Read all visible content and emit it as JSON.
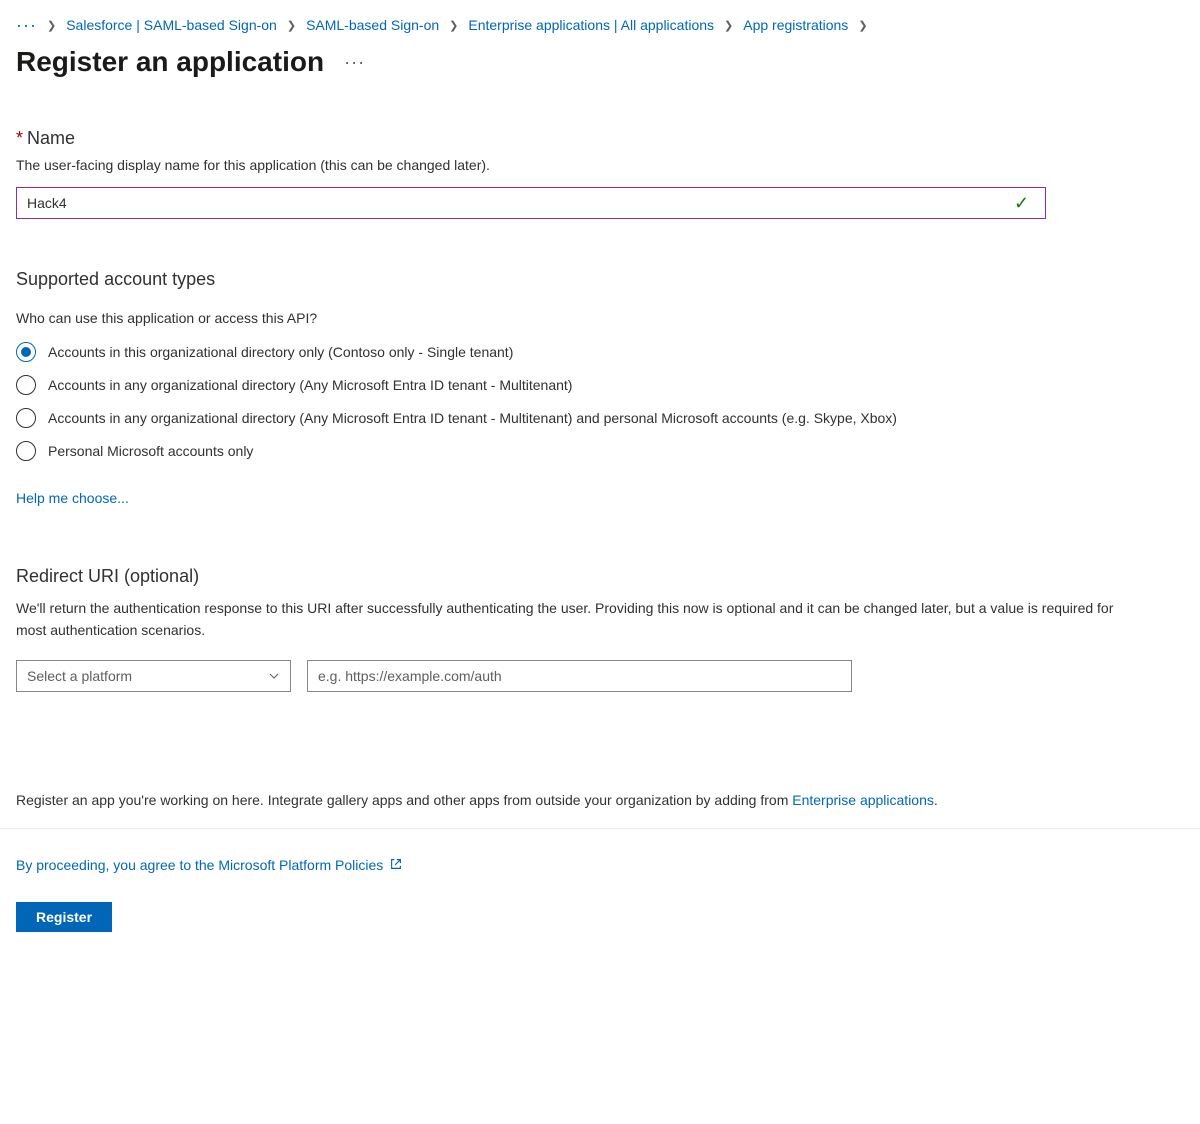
{
  "breadcrumb": {
    "items": [
      "Salesforce | SAML-based Sign-on",
      "SAML-based Sign-on",
      "Enterprise applications | All applications",
      "App registrations"
    ]
  },
  "page": {
    "title": "Register an application"
  },
  "name_section": {
    "label": "Name",
    "description": "The user-facing display name for this application (this can be changed later).",
    "value": "Hack4"
  },
  "account_section": {
    "heading": "Supported account types",
    "question": "Who can use this application or access this API?",
    "options": [
      "Accounts in this organizational directory only (Contoso only - Single tenant)",
      "Accounts in any organizational directory (Any Microsoft Entra ID tenant - Multitenant)",
      "Accounts in any organizational directory (Any Microsoft Entra ID tenant - Multitenant) and personal Microsoft accounts (e.g. Skype, Xbox)",
      "Personal Microsoft accounts only"
    ],
    "help_link": "Help me choose..."
  },
  "redirect_section": {
    "heading": "Redirect URI (optional)",
    "description": "We'll return the authentication response to this URI after successfully authenticating the user. Providing this now is optional and it can be changed later, but a value is required for most authentication scenarios.",
    "platform_placeholder": "Select a platform",
    "uri_placeholder": "e.g. https://example.com/auth"
  },
  "footer": {
    "note_prefix": "Register an app you're working on here. Integrate gallery apps and other apps from outside your organization by adding from ",
    "note_link": "Enterprise applications",
    "note_suffix": ".",
    "policy_text": "By proceeding, you agree to the Microsoft Platform Policies",
    "register_label": "Register"
  }
}
